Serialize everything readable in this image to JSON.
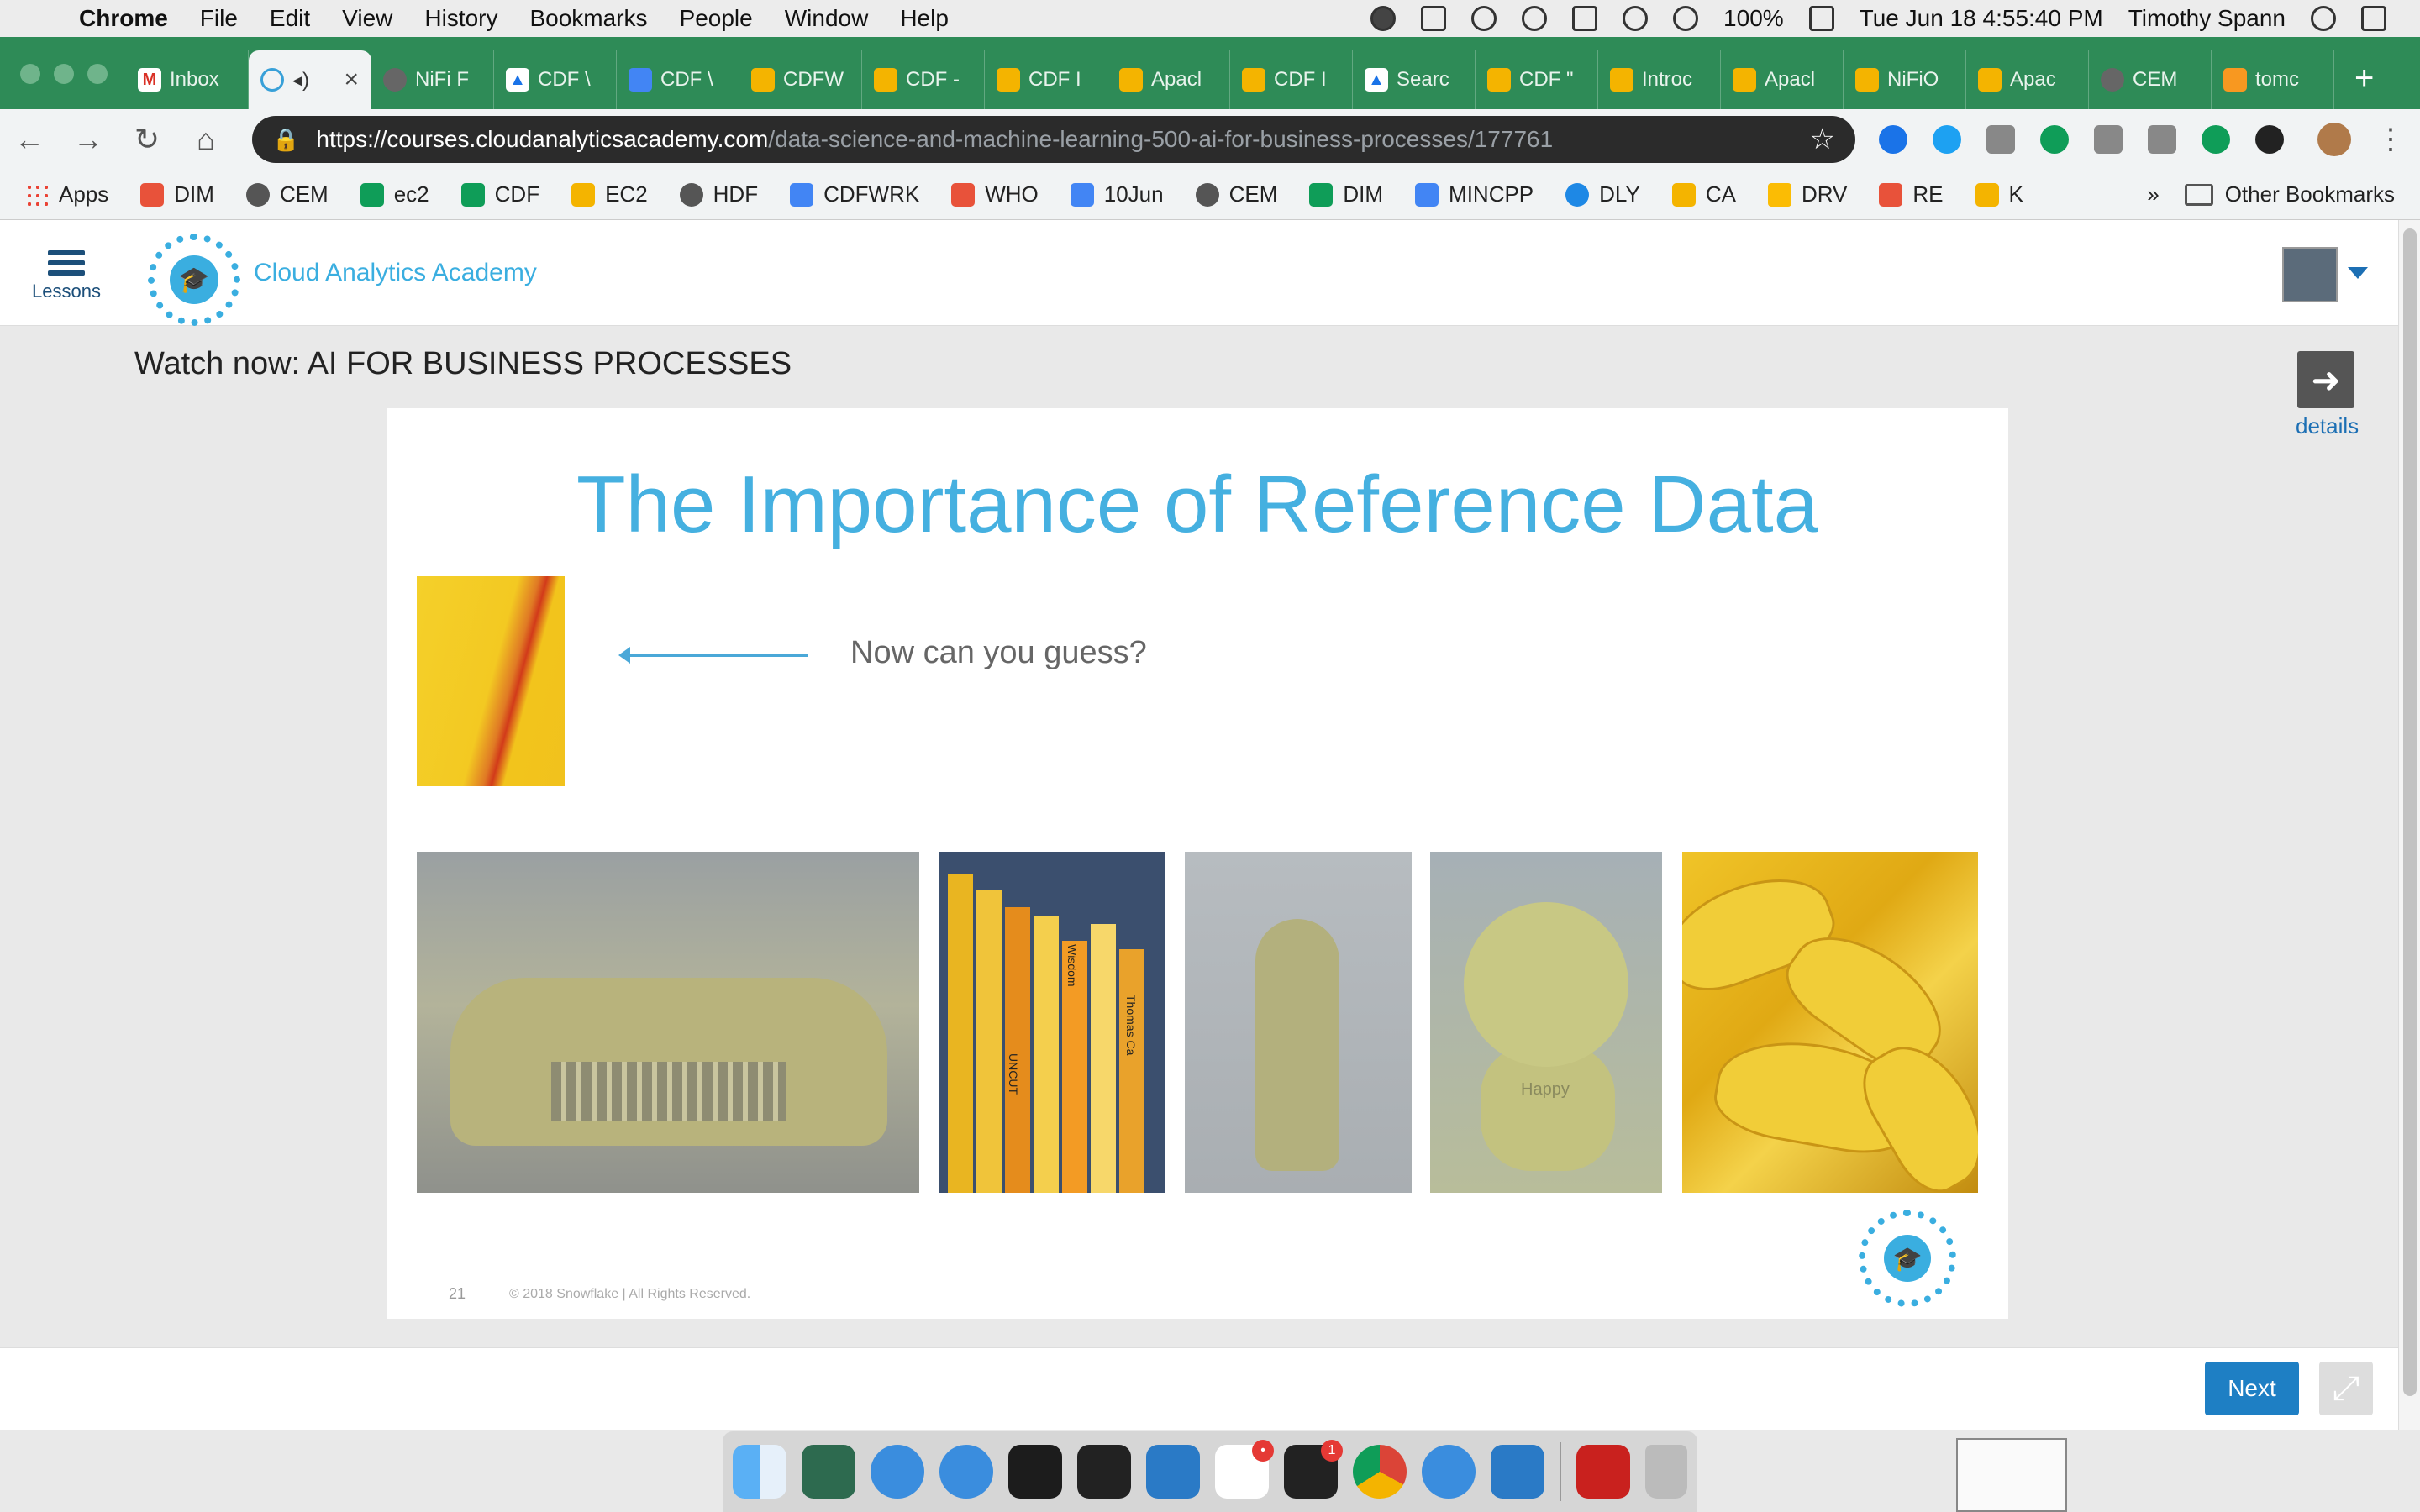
{
  "menubar": {
    "app": "Chrome",
    "items": [
      "File",
      "Edit",
      "View",
      "History",
      "Bookmarks",
      "People",
      "Window",
      "Help"
    ],
    "battery": "100%",
    "datetime": "Tue Jun 18  4:55:40 PM",
    "user": "Timothy Spann"
  },
  "tabs": [
    {
      "label": "Inbox",
      "icon": "gmail-icon"
    },
    {
      "label": "",
      "icon": "gear-icon",
      "active": true
    },
    {
      "label": "NiFi F",
      "icon": "nifi-icon"
    },
    {
      "label": "CDF \\",
      "icon": "drive-icon"
    },
    {
      "label": "CDF \\",
      "icon": "doc-icon"
    },
    {
      "label": "CDFW",
      "icon": "slides-icon"
    },
    {
      "label": "CDF -",
      "icon": "slides-icon"
    },
    {
      "label": "CDF I",
      "icon": "slides-icon"
    },
    {
      "label": "Apacl",
      "icon": "slides-icon"
    },
    {
      "label": "CDF I",
      "icon": "slides-icon"
    },
    {
      "label": "Searc",
      "icon": "drive-icon"
    },
    {
      "label": "CDF \"",
      "icon": "slides-icon"
    },
    {
      "label": "Introc",
      "icon": "slides-icon"
    },
    {
      "label": "Apacl",
      "icon": "slides-icon"
    },
    {
      "label": "NiFiO",
      "icon": "slides-icon"
    },
    {
      "label": "Apac",
      "icon": "slides-icon"
    },
    {
      "label": "CEM",
      "icon": "globe-icon"
    },
    {
      "label": "tomc",
      "icon": "java-icon"
    }
  ],
  "omnibox": {
    "host": "https://courses.cloudanalyticsacademy.com",
    "path": "/data-science-and-machine-learning-500-ai-for-business-processes/177761"
  },
  "bookmarks": [
    {
      "label": "Apps",
      "icon": "apps-icon"
    },
    {
      "label": "DIM",
      "icon": "asana-icon"
    },
    {
      "label": "CEM",
      "icon": "globe-icon"
    },
    {
      "label": "ec2",
      "icon": "sheet-icon"
    },
    {
      "label": "CDF",
      "icon": "sheet-icon"
    },
    {
      "label": "EC2",
      "icon": "box-icon"
    },
    {
      "label": "HDF",
      "icon": "nifi-icon"
    },
    {
      "label": "CDFWRK",
      "icon": "doc-icon"
    },
    {
      "label": "WHO",
      "icon": "chrome-icon"
    },
    {
      "label": "10Jun",
      "icon": "doc-icon"
    },
    {
      "label": "CEM",
      "icon": "globe-icon"
    },
    {
      "label": "DIM",
      "icon": "sheet-icon"
    },
    {
      "label": "MINCPP",
      "icon": "doc-icon"
    },
    {
      "label": "DLY",
      "icon": "cloud-icon"
    },
    {
      "label": "CA",
      "icon": "star-icon"
    },
    {
      "label": "DRV",
      "icon": "drive-icon"
    },
    {
      "label": "RE",
      "icon": "re-icon"
    },
    {
      "label": "K",
      "icon": "bulb-icon"
    }
  ],
  "bookmarks_more": "»",
  "other_bookmarks": "Other Bookmarks",
  "header": {
    "lessons_label": "Lessons",
    "brand": "Cloud Analytics Academy"
  },
  "watch_title": "Watch now: AI FOR BUSINESS PROCESSES",
  "details_label": "details",
  "slide": {
    "title": "The Importance of Reference Data",
    "guess_text": "Now can you guess?",
    "page_number": "21",
    "copyright": "© 2018 Snowflake  |  All Rights Reserved.",
    "book_text": [
      "UNCUT",
      "Wisdom",
      "Thomas Ca"
    ],
    "plush_text": "Happy"
  },
  "footer": {
    "next_label": "Next"
  },
  "dock": {
    "badges": [
      "•",
      "1"
    ]
  },
  "colors": {
    "accent": "#3aaee0",
    "tabstrip": "#2e8b57",
    "next": "#1e7fc4"
  }
}
